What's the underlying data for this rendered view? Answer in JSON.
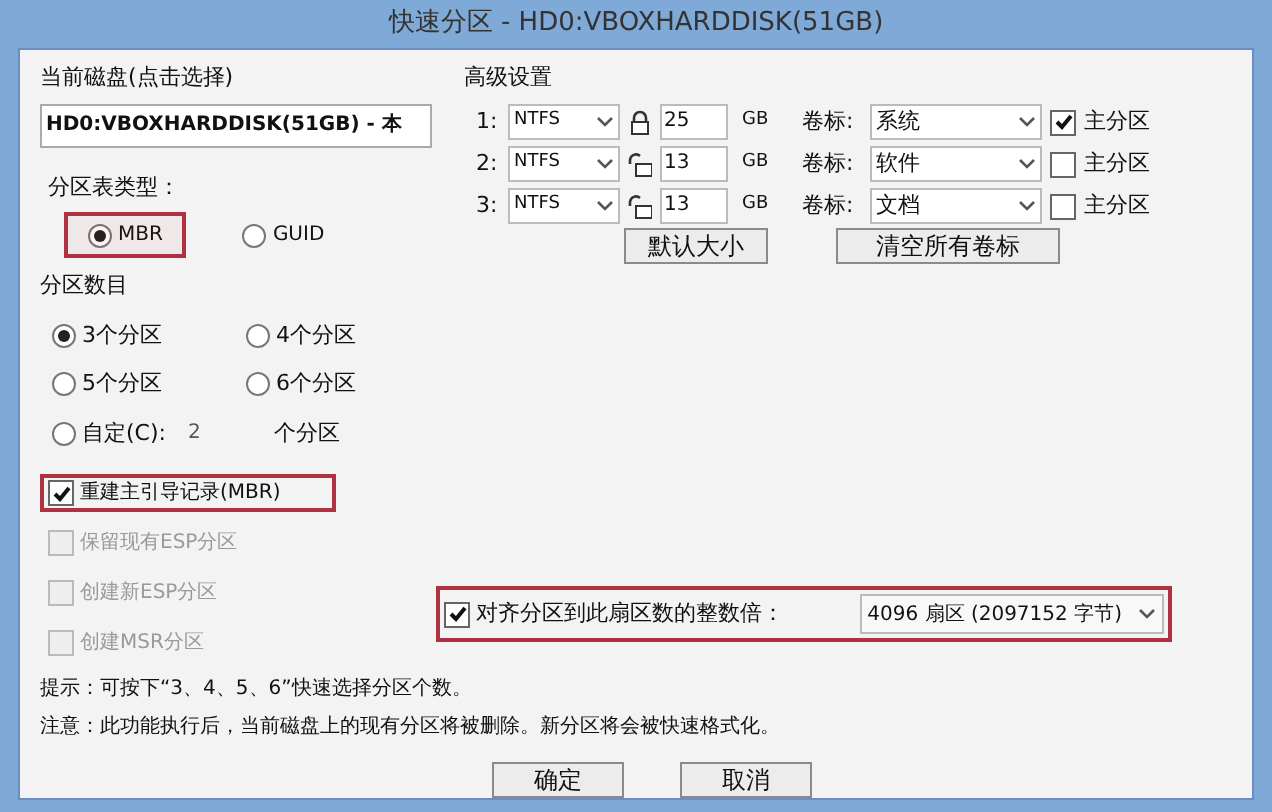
{
  "window": {
    "title": "快速分区 - HD0:VBOXHARDDISK(51GB)"
  },
  "disk": {
    "label": "当前磁盘(点击选择)",
    "value": "HD0:VBOXHARDDISK(51GB) - 本"
  },
  "partition_table": {
    "label": "分区表类型：",
    "options": [
      {
        "label": "MBR",
        "selected": true,
        "highlighted": true
      },
      {
        "label": "GUID",
        "selected": false,
        "highlighted": false
      }
    ]
  },
  "partition_count": {
    "label": "分区数目",
    "options": [
      {
        "label": "3个分区",
        "selected": true
      },
      {
        "label": "4个分区",
        "selected": false
      },
      {
        "label": "5个分区",
        "selected": false
      },
      {
        "label": "6个分区",
        "selected": false
      }
    ],
    "custom": {
      "label": "自定(C):",
      "value": "2",
      "suffix": "个分区",
      "selected": false
    }
  },
  "options": [
    {
      "label": "重建主引导记录(MBR)",
      "checked": true,
      "disabled": false,
      "highlighted": true
    },
    {
      "label": "保留现有ESP分区",
      "checked": false,
      "disabled": true,
      "highlighted": false
    },
    {
      "label": "创建新ESP分区",
      "checked": false,
      "disabled": true,
      "highlighted": false
    },
    {
      "label": "创建MSR分区",
      "checked": false,
      "disabled": true,
      "highlighted": false
    }
  ],
  "advanced": {
    "label": "高级设置",
    "rows": [
      {
        "index": "1:",
        "fs": "NTFS",
        "locked": true,
        "size": "25",
        "unit": "GB",
        "volume_label_caption": "卷标:",
        "volume_label": "系统",
        "primary_label": "主分区",
        "primary": true
      },
      {
        "index": "2:",
        "fs": "NTFS",
        "locked": false,
        "size": "13",
        "unit": "GB",
        "volume_label_caption": "卷标:",
        "volume_label": "软件",
        "primary_label": "主分区",
        "primary": false
      },
      {
        "index": "3:",
        "fs": "NTFS",
        "locked": false,
        "size": "13",
        "unit": "GB",
        "volume_label_caption": "卷标:",
        "volume_label": "文档",
        "primary_label": "主分区",
        "primary": false
      }
    ],
    "buttons": [
      "默认大小",
      "清空所有卷标"
    ]
  },
  "align": {
    "label": "对齐分区到此扇区数的整数倍：",
    "checked": true,
    "value": "4096 扇区 (2097152 字节)",
    "highlighted": true
  },
  "hints": [
    "提示：可按下“3、4、5、6”快速选择分区个数。",
    "注意：此功能执行后，当前磁盘上的现有分区将被删除。新分区将会被快速格式化。"
  ],
  "buttons": [
    "确定",
    "取消"
  ]
}
